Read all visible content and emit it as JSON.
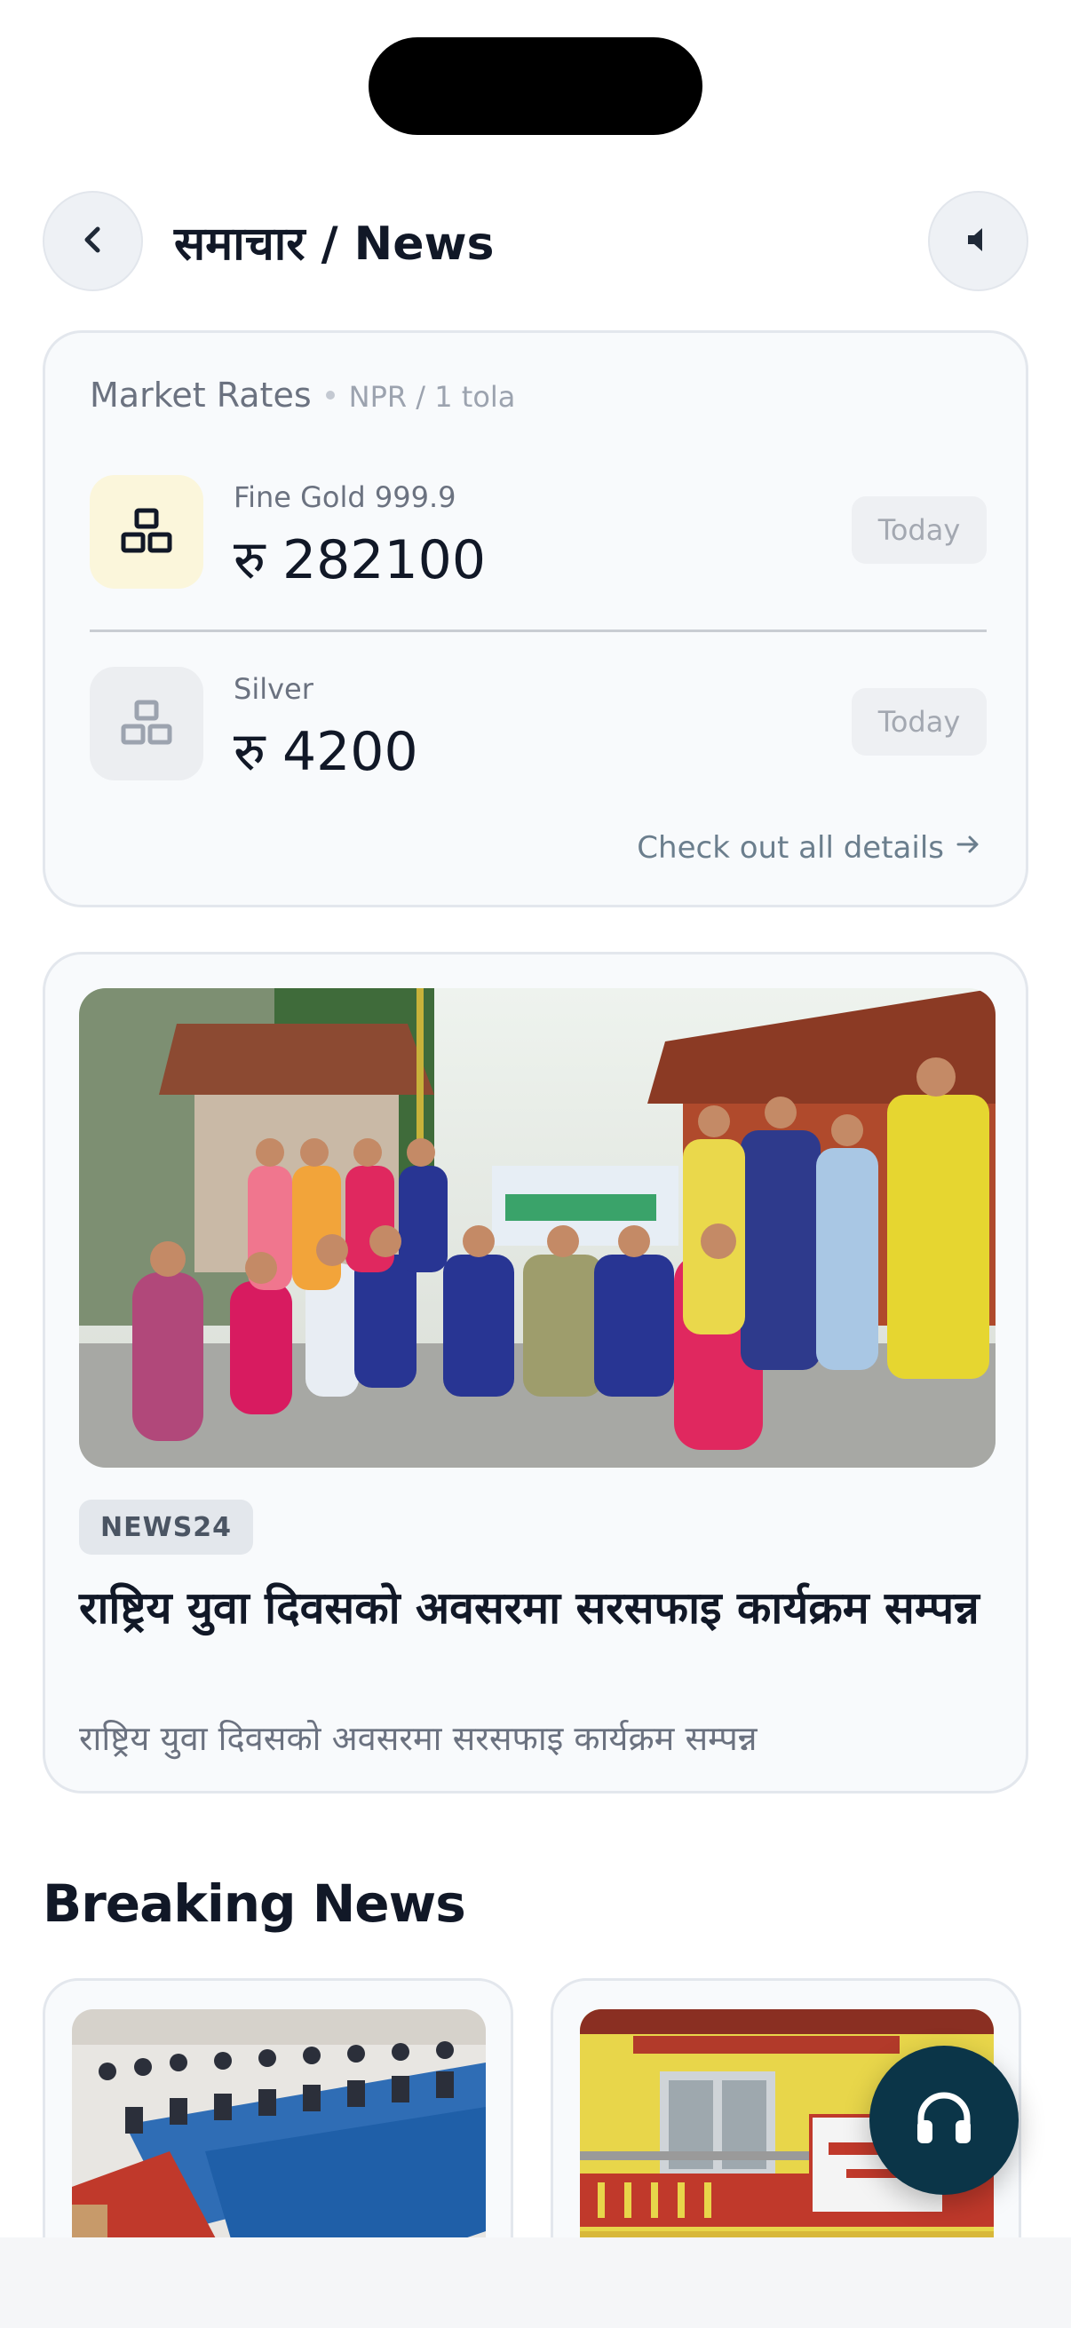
{
  "header": {
    "title": "समाचार / News",
    "back_icon": "chevron-left-icon",
    "sound_icon": "speaker-icon"
  },
  "market": {
    "title": "Market Rates",
    "subtitle": "NPR / 1 tola",
    "rates": [
      {
        "label": "Fine Gold 999.9",
        "value": "रु 282100",
        "badge": "Today",
        "icon": "gold-bars-icon",
        "icon_color": "#111827",
        "bg": "#fbf6db"
      },
      {
        "label": "Silver",
        "value": "रु 4200",
        "badge": "Today",
        "icon": "silver-bars-icon",
        "icon_color": "#9ca3af",
        "bg": "#eceef1"
      }
    ],
    "details_link": "Check out all details",
    "details_icon": "arrow-right-icon"
  },
  "featured": {
    "source": "NEWS24",
    "title": "राष्ट्रिय युवा दिवसको अवसरमा सरसफाइ कार्यक्रम सम्पन्न",
    "summary": "राष्ट्रिय युवा दिवसको अवसरमा सरसफाइ कार्यक्रम सम्पन्न"
  },
  "breaking": {
    "title": "Breaking News"
  },
  "fab": {
    "icon": "headphones-icon",
    "color": "#0b3548"
  }
}
